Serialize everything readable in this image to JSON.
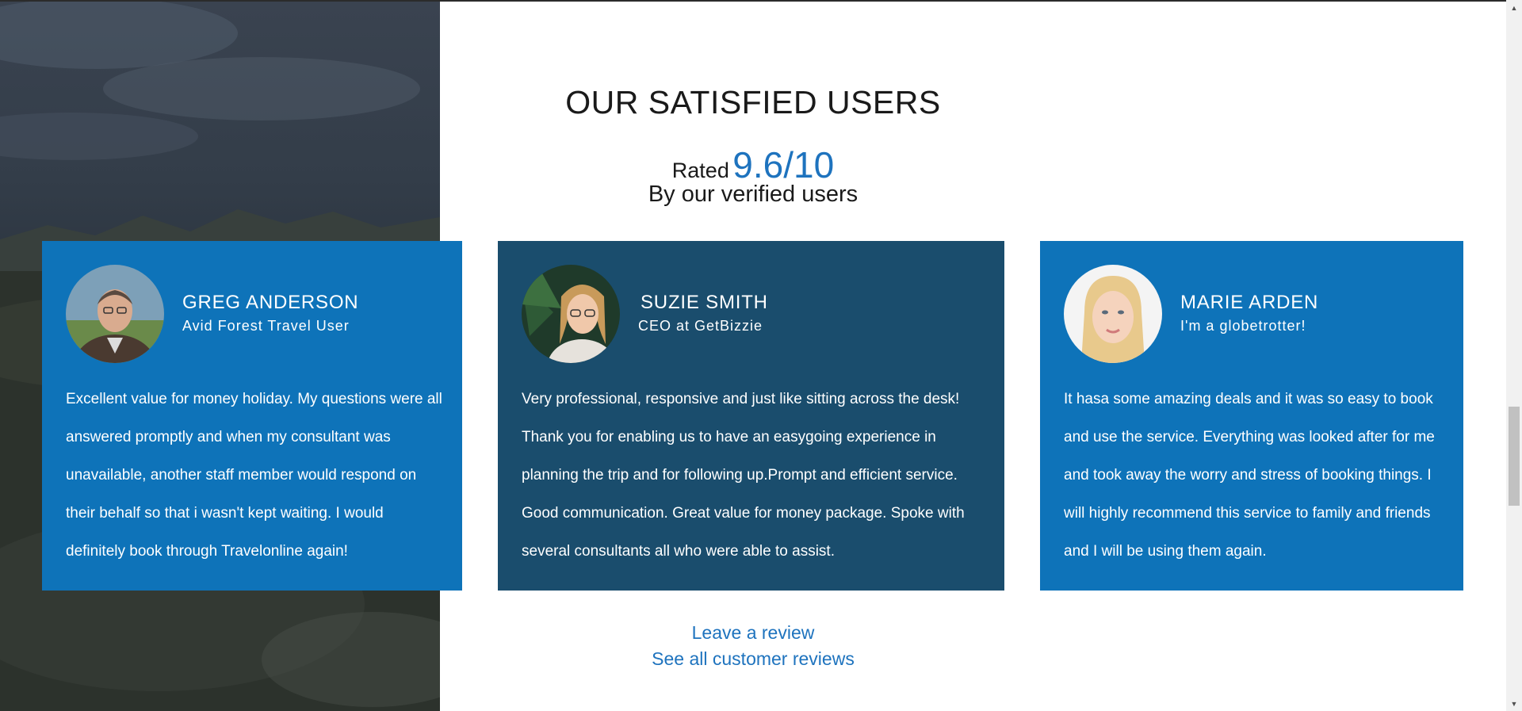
{
  "section": {
    "title": "OUR SATISFIED USERS",
    "rated_word": "Rated",
    "rating_score": "9.6/10",
    "rating_sub": "By our verified users"
  },
  "testimonials": [
    {
      "name": "GREG ANDERSON",
      "role": "Avid Forest Travel User",
      "text": "Excellent value for money holiday. My questions were all answered promptly and when my consultant was unavailable, another staff member would respond on their behalf so that i wasn't kept waiting. I would definitely book through Travelonline again!"
    },
    {
      "name": "SUZIE SMITH",
      "role": "CEO at GetBizzie",
      "text": "Very professional, responsive and just like sitting across the desk! Thank you for enabling us to have an easygoing experience in planning the trip and for following up.Prompt and efficient service. Good communication. Great value for money package. Spoke with several consultants all who were able to assist."
    },
    {
      "name": "MARIE ARDEN",
      "role": "I'm a globetrotter!",
      "text": "It hasa some amazing deals and it was so easy to book and use the service. Everything was looked after for me and took away the worry and stress of booking things. I will highly recommend this service to family and friends and I will be using them again."
    }
  ],
  "links": {
    "leave_review": "Leave a review",
    "see_all": "See all customer reviews"
  },
  "colors": {
    "card_blue": "#0e73b9",
    "card_dark": "#1a4d6d",
    "accent": "#1e73be"
  }
}
